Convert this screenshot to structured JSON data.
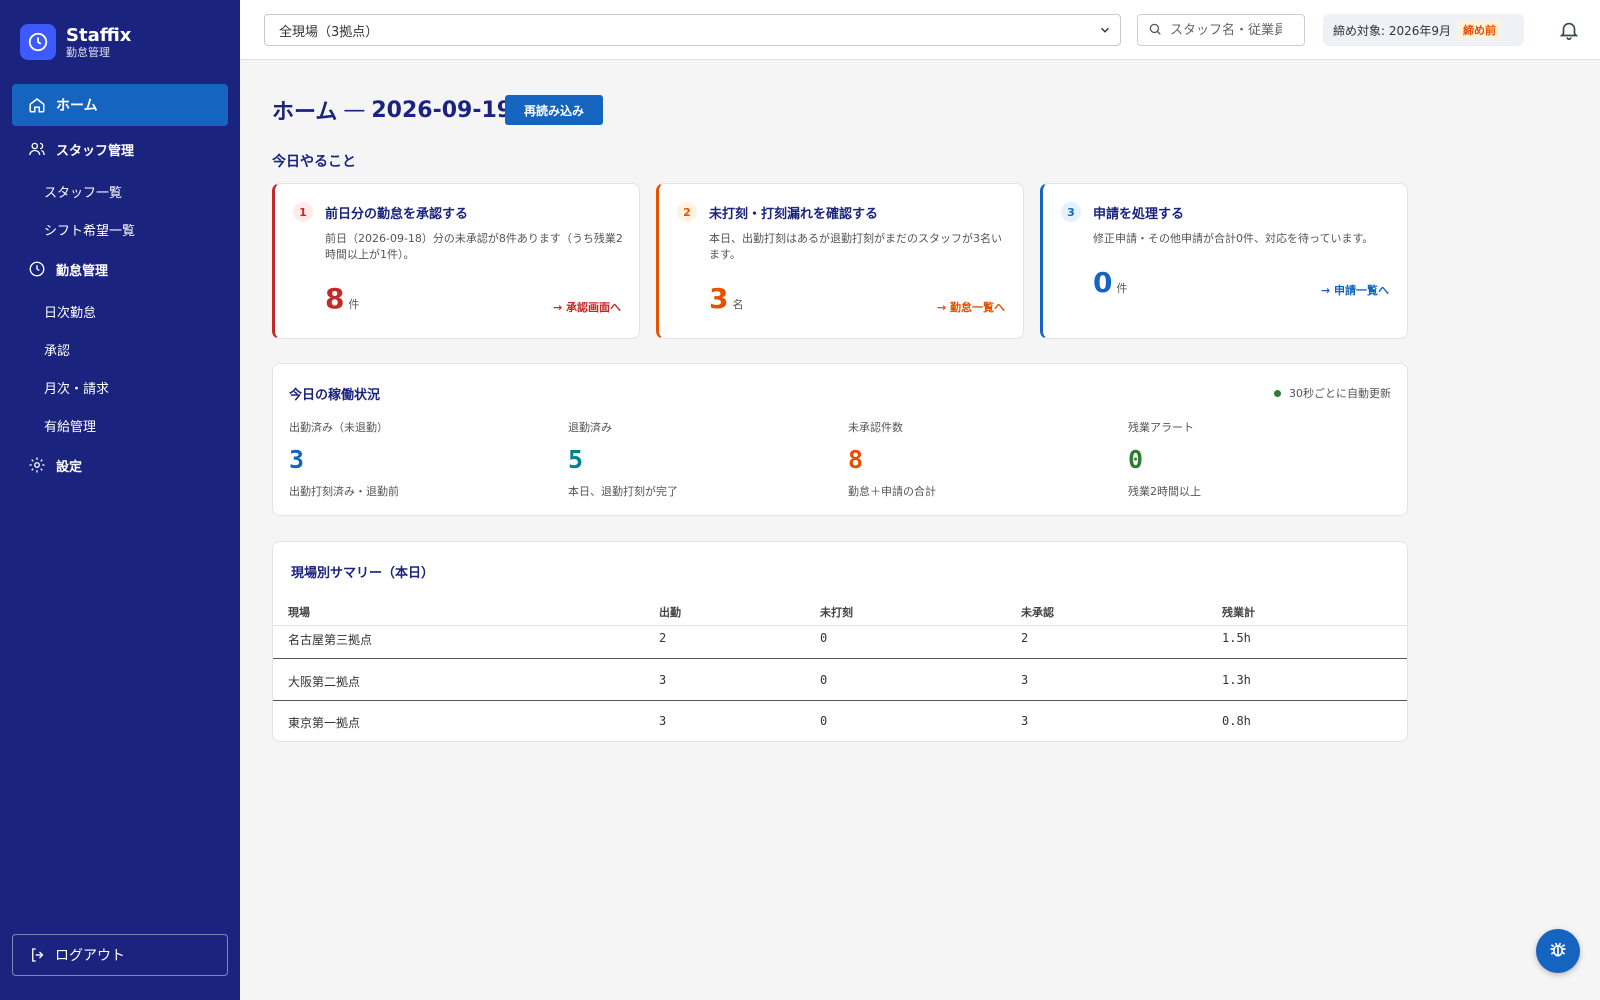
{
  "brand": {
    "name": "Staffix",
    "subtitle": "勤怠管理"
  },
  "nav": {
    "home": "ホーム",
    "staff": "スタッフ管理",
    "staff_list": "スタッフ一覧",
    "shift_requests": "シフト希望一覧",
    "attendance": "勤怠管理",
    "daily": "日次勤怠",
    "approval": "承認",
    "monthly": "月次・請求",
    "paid_leave": "有給管理",
    "settings": "設定",
    "logout": "ログアウト"
  },
  "topbar": {
    "site_selected": "全現場（3拠点）",
    "search_placeholder": "スタッフ名・従業員",
    "period_label": "締め対象: 2026年9月",
    "period_status": "締め前"
  },
  "page": {
    "title": "ホーム",
    "separator": "—",
    "date": "2026-09-19",
    "reload_label": "再読み込み",
    "todo_heading": "今日やること"
  },
  "tasks": [
    {
      "num": "1",
      "title": "前日分の勤怠を承認する",
      "desc": "前日（2026-09-18）分の未承認が8件あります（うち残業2時間以上が1件）。",
      "value": "8",
      "unit": "件",
      "link": "→ 承認画面へ",
      "color": "#c62828"
    },
    {
      "num": "2",
      "title": "未打刻・打刻漏れを確認する",
      "desc": "本日、出勤打刻はあるが退勤打刻がまだのスタッフが3名います。",
      "value": "3",
      "unit": "名",
      "link": "→ 勤怠一覧へ",
      "color": "#e65100"
    },
    {
      "num": "3",
      "title": "申請を処理する",
      "desc": "修正申請・その他申請が合計0件、対応を待っています。",
      "value": "0",
      "unit": "件",
      "link": "→ 申請一覧へ",
      "color": "#1565c0"
    }
  ],
  "ops": {
    "title": "今日の稼働状況",
    "auto_refresh": "30秒ごとに自動更新",
    "stats": [
      {
        "label": "出勤済み（未退勤）",
        "value": "3",
        "note": "出勤打刻済み・退勤前",
        "color": "#1565c0"
      },
      {
        "label": "退勤済み",
        "value": "5",
        "note": "本日、退勤打刻が完了",
        "color": "#00838f"
      },
      {
        "label": "未承認件数",
        "value": "8",
        "note": "勤怠＋申請の合計",
        "color": "#e65100"
      },
      {
        "label": "残業アラート",
        "value": "0",
        "note": "残業2時間以上",
        "color": "#2e7d32"
      }
    ]
  },
  "summary": {
    "title": "現場別サマリー（本日）",
    "headers": [
      "現場",
      "出勤",
      "未打刻",
      "未承認",
      "残業計"
    ],
    "rows": [
      [
        "名古屋第三拠点",
        "2",
        "0",
        "2",
        "1.5h"
      ],
      [
        "大阪第二拠点",
        "3",
        "0",
        "3",
        "1.3h"
      ],
      [
        "東京第一拠点",
        "3",
        "0",
        "3",
        "0.8h"
      ]
    ]
  }
}
